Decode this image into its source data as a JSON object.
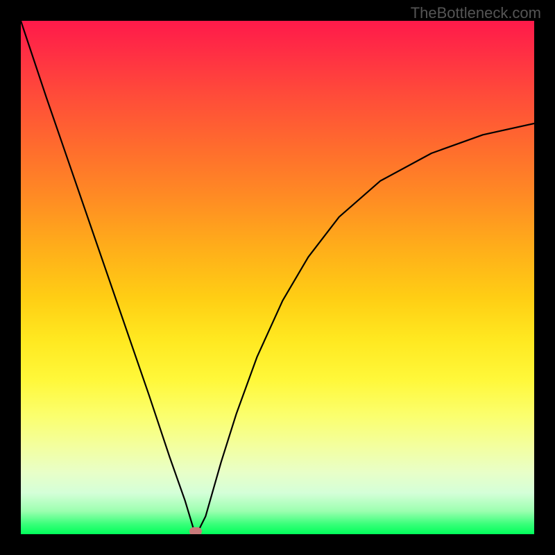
{
  "watermark": "TheBottleneck.com",
  "chart_data": {
    "type": "line",
    "title": "",
    "xlabel": "",
    "ylabel": "",
    "xlim": [
      0,
      1
    ],
    "ylim": [
      0,
      1
    ],
    "series": [
      {
        "name": "curve",
        "x": [
          0.0,
          0.05,
          0.1,
          0.15,
          0.2,
          0.25,
          0.29,
          0.32,
          0.336,
          0.34,
          0.345,
          0.36,
          0.39,
          0.42,
          0.46,
          0.51,
          0.56,
          0.62,
          0.7,
          0.8,
          0.9,
          1.0
        ],
        "y": [
          1.0,
          0.85,
          0.705,
          0.56,
          0.415,
          0.27,
          0.15,
          0.065,
          0.012,
          0.002,
          0.005,
          0.035,
          0.14,
          0.235,
          0.345,
          0.455,
          0.54,
          0.618,
          0.688,
          0.742,
          0.778,
          0.8
        ]
      }
    ],
    "marker": {
      "x": 0.34,
      "y": 0.0
    },
    "gradient_stops": [
      {
        "pos": 0.0,
        "color": "#ff1a4a"
      },
      {
        "pos": 0.5,
        "color": "#ffd015"
      },
      {
        "pos": 0.8,
        "color": "#f7ff80"
      },
      {
        "pos": 1.0,
        "color": "#00ff5a"
      }
    ]
  }
}
